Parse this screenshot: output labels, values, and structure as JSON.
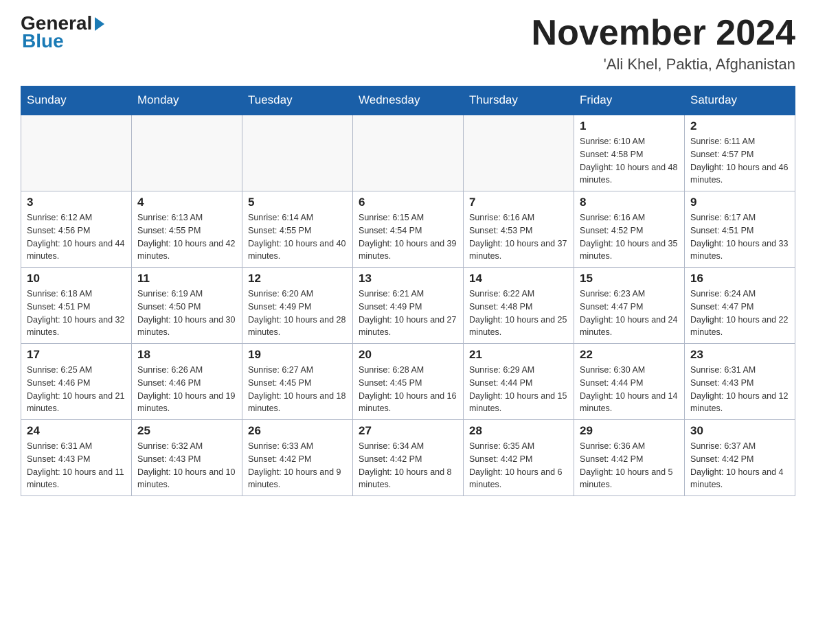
{
  "header": {
    "logo_text": "General",
    "logo_blue": "Blue",
    "month_year": "November 2024",
    "location": "'Ali Khel, Paktia, Afghanistan"
  },
  "weekdays": [
    "Sunday",
    "Monday",
    "Tuesday",
    "Wednesday",
    "Thursday",
    "Friday",
    "Saturday"
  ],
  "weeks": [
    [
      {
        "day": "",
        "info": ""
      },
      {
        "day": "",
        "info": ""
      },
      {
        "day": "",
        "info": ""
      },
      {
        "day": "",
        "info": ""
      },
      {
        "day": "",
        "info": ""
      },
      {
        "day": "1",
        "info": "Sunrise: 6:10 AM\nSunset: 4:58 PM\nDaylight: 10 hours and 48 minutes."
      },
      {
        "day": "2",
        "info": "Sunrise: 6:11 AM\nSunset: 4:57 PM\nDaylight: 10 hours and 46 minutes."
      }
    ],
    [
      {
        "day": "3",
        "info": "Sunrise: 6:12 AM\nSunset: 4:56 PM\nDaylight: 10 hours and 44 minutes."
      },
      {
        "day": "4",
        "info": "Sunrise: 6:13 AM\nSunset: 4:55 PM\nDaylight: 10 hours and 42 minutes."
      },
      {
        "day": "5",
        "info": "Sunrise: 6:14 AM\nSunset: 4:55 PM\nDaylight: 10 hours and 40 minutes."
      },
      {
        "day": "6",
        "info": "Sunrise: 6:15 AM\nSunset: 4:54 PM\nDaylight: 10 hours and 39 minutes."
      },
      {
        "day": "7",
        "info": "Sunrise: 6:16 AM\nSunset: 4:53 PM\nDaylight: 10 hours and 37 minutes."
      },
      {
        "day": "8",
        "info": "Sunrise: 6:16 AM\nSunset: 4:52 PM\nDaylight: 10 hours and 35 minutes."
      },
      {
        "day": "9",
        "info": "Sunrise: 6:17 AM\nSunset: 4:51 PM\nDaylight: 10 hours and 33 minutes."
      }
    ],
    [
      {
        "day": "10",
        "info": "Sunrise: 6:18 AM\nSunset: 4:51 PM\nDaylight: 10 hours and 32 minutes."
      },
      {
        "day": "11",
        "info": "Sunrise: 6:19 AM\nSunset: 4:50 PM\nDaylight: 10 hours and 30 minutes."
      },
      {
        "day": "12",
        "info": "Sunrise: 6:20 AM\nSunset: 4:49 PM\nDaylight: 10 hours and 28 minutes."
      },
      {
        "day": "13",
        "info": "Sunrise: 6:21 AM\nSunset: 4:49 PM\nDaylight: 10 hours and 27 minutes."
      },
      {
        "day": "14",
        "info": "Sunrise: 6:22 AM\nSunset: 4:48 PM\nDaylight: 10 hours and 25 minutes."
      },
      {
        "day": "15",
        "info": "Sunrise: 6:23 AM\nSunset: 4:47 PM\nDaylight: 10 hours and 24 minutes."
      },
      {
        "day": "16",
        "info": "Sunrise: 6:24 AM\nSunset: 4:47 PM\nDaylight: 10 hours and 22 minutes."
      }
    ],
    [
      {
        "day": "17",
        "info": "Sunrise: 6:25 AM\nSunset: 4:46 PM\nDaylight: 10 hours and 21 minutes."
      },
      {
        "day": "18",
        "info": "Sunrise: 6:26 AM\nSunset: 4:46 PM\nDaylight: 10 hours and 19 minutes."
      },
      {
        "day": "19",
        "info": "Sunrise: 6:27 AM\nSunset: 4:45 PM\nDaylight: 10 hours and 18 minutes."
      },
      {
        "day": "20",
        "info": "Sunrise: 6:28 AM\nSunset: 4:45 PM\nDaylight: 10 hours and 16 minutes."
      },
      {
        "day": "21",
        "info": "Sunrise: 6:29 AM\nSunset: 4:44 PM\nDaylight: 10 hours and 15 minutes."
      },
      {
        "day": "22",
        "info": "Sunrise: 6:30 AM\nSunset: 4:44 PM\nDaylight: 10 hours and 14 minutes."
      },
      {
        "day": "23",
        "info": "Sunrise: 6:31 AM\nSunset: 4:43 PM\nDaylight: 10 hours and 12 minutes."
      }
    ],
    [
      {
        "day": "24",
        "info": "Sunrise: 6:31 AM\nSunset: 4:43 PM\nDaylight: 10 hours and 11 minutes."
      },
      {
        "day": "25",
        "info": "Sunrise: 6:32 AM\nSunset: 4:43 PM\nDaylight: 10 hours and 10 minutes."
      },
      {
        "day": "26",
        "info": "Sunrise: 6:33 AM\nSunset: 4:42 PM\nDaylight: 10 hours and 9 minutes."
      },
      {
        "day": "27",
        "info": "Sunrise: 6:34 AM\nSunset: 4:42 PM\nDaylight: 10 hours and 8 minutes."
      },
      {
        "day": "28",
        "info": "Sunrise: 6:35 AM\nSunset: 4:42 PM\nDaylight: 10 hours and 6 minutes."
      },
      {
        "day": "29",
        "info": "Sunrise: 6:36 AM\nSunset: 4:42 PM\nDaylight: 10 hours and 5 minutes."
      },
      {
        "day": "30",
        "info": "Sunrise: 6:37 AM\nSunset: 4:42 PM\nDaylight: 10 hours and 4 minutes."
      }
    ]
  ]
}
